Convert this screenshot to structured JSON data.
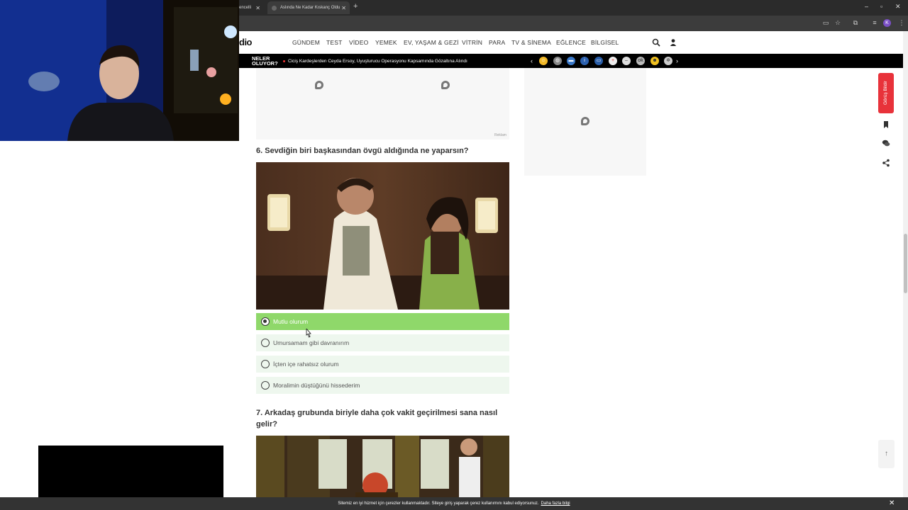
{
  "browser": {
    "prev_tab_title": "encelli",
    "active_tab_title": "Aslında Ne Kadar Kıskanç Oldu",
    "new_tab_icon": "+",
    "window_controls": [
      "–",
      "▫",
      "✕"
    ]
  },
  "site": {
    "logo": "dio",
    "nav": [
      "GÜNDEM",
      "TEST",
      "VİDEO",
      "YEMEK",
      "EV, YAŞAM & GEZİ",
      "VİTRİN",
      "PARA",
      "TV & SİNEMA",
      "EĞLENCE",
      "BİLGİSEL"
    ]
  },
  "ticker": {
    "label_line1": "NELER",
    "label_line2": "OLUYOR?",
    "headline": "Ciciş Kardeşlerden Ceyda Ersoy, Uyuşturucu Operasyonu Kapsamında Gözaltına Alındı",
    "prev": "‹",
    "next": "›"
  },
  "ad": {
    "label": "Reklam"
  },
  "quiz": {
    "q6": {
      "title": "6. Sevdiğin biri başkasından övgü aldığında ne yaparsın?",
      "options": [
        {
          "label": "Mutlu olurum",
          "selected": true
        },
        {
          "label": "Umursamam gibi davranırım",
          "selected": false
        },
        {
          "label": "İçten içe rahatsız olurum",
          "selected": false
        },
        {
          "label": "Moralimin düştüğünü hissederim",
          "selected": false
        }
      ]
    },
    "q7": {
      "title": "7. Arkadaş grubunda biriyle daha çok vakit geçirilmesi sana nasıl gelir?"
    }
  },
  "sidebar": {
    "opinion_button": "Görüş Bildir",
    "scroll_top": "↑"
  },
  "cookie": {
    "text": "Sitemiz en iyi hizmet için çerezler kullanmaktadır. Siteye giriş yaparak çerez kullanımını kabul ediyorsunuz.",
    "link": "Daha fazla bilgi",
    "close": "✕"
  },
  "colors": {
    "selected_option": "#8fd86a",
    "option_bg": "#eef7ee",
    "opinion_button": "#e8323a"
  }
}
